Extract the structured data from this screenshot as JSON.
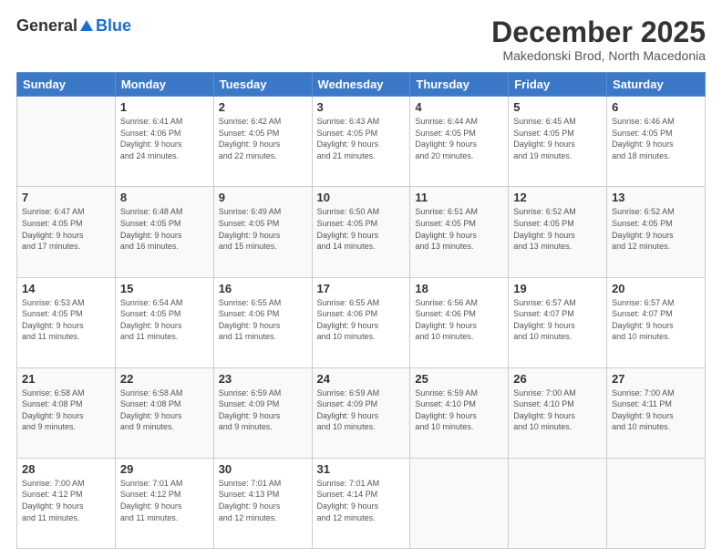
{
  "logo": {
    "general": "General",
    "blue": "Blue"
  },
  "title": "December 2025",
  "subtitle": "Makedonski Brod, North Macedonia",
  "weekdays": [
    "Sunday",
    "Monday",
    "Tuesday",
    "Wednesday",
    "Thursday",
    "Friday",
    "Saturday"
  ],
  "weeks": [
    [
      {
        "day": "",
        "info": ""
      },
      {
        "day": "1",
        "info": "Sunrise: 6:41 AM\nSunset: 4:06 PM\nDaylight: 9 hours\nand 24 minutes."
      },
      {
        "day": "2",
        "info": "Sunrise: 6:42 AM\nSunset: 4:05 PM\nDaylight: 9 hours\nand 22 minutes."
      },
      {
        "day": "3",
        "info": "Sunrise: 6:43 AM\nSunset: 4:05 PM\nDaylight: 9 hours\nand 21 minutes."
      },
      {
        "day": "4",
        "info": "Sunrise: 6:44 AM\nSunset: 4:05 PM\nDaylight: 9 hours\nand 20 minutes."
      },
      {
        "day": "5",
        "info": "Sunrise: 6:45 AM\nSunset: 4:05 PM\nDaylight: 9 hours\nand 19 minutes."
      },
      {
        "day": "6",
        "info": "Sunrise: 6:46 AM\nSunset: 4:05 PM\nDaylight: 9 hours\nand 18 minutes."
      }
    ],
    [
      {
        "day": "7",
        "info": "Sunrise: 6:47 AM\nSunset: 4:05 PM\nDaylight: 9 hours\nand 17 minutes."
      },
      {
        "day": "8",
        "info": "Sunrise: 6:48 AM\nSunset: 4:05 PM\nDaylight: 9 hours\nand 16 minutes."
      },
      {
        "day": "9",
        "info": "Sunrise: 6:49 AM\nSunset: 4:05 PM\nDaylight: 9 hours\nand 15 minutes."
      },
      {
        "day": "10",
        "info": "Sunrise: 6:50 AM\nSunset: 4:05 PM\nDaylight: 9 hours\nand 14 minutes."
      },
      {
        "day": "11",
        "info": "Sunrise: 6:51 AM\nSunset: 4:05 PM\nDaylight: 9 hours\nand 13 minutes."
      },
      {
        "day": "12",
        "info": "Sunrise: 6:52 AM\nSunset: 4:05 PM\nDaylight: 9 hours\nand 13 minutes."
      },
      {
        "day": "13",
        "info": "Sunrise: 6:52 AM\nSunset: 4:05 PM\nDaylight: 9 hours\nand 12 minutes."
      }
    ],
    [
      {
        "day": "14",
        "info": "Sunrise: 6:53 AM\nSunset: 4:05 PM\nDaylight: 9 hours\nand 11 minutes."
      },
      {
        "day": "15",
        "info": "Sunrise: 6:54 AM\nSunset: 4:05 PM\nDaylight: 9 hours\nand 11 minutes."
      },
      {
        "day": "16",
        "info": "Sunrise: 6:55 AM\nSunset: 4:06 PM\nDaylight: 9 hours\nand 11 minutes."
      },
      {
        "day": "17",
        "info": "Sunrise: 6:55 AM\nSunset: 4:06 PM\nDaylight: 9 hours\nand 10 minutes."
      },
      {
        "day": "18",
        "info": "Sunrise: 6:56 AM\nSunset: 4:06 PM\nDaylight: 9 hours\nand 10 minutes."
      },
      {
        "day": "19",
        "info": "Sunrise: 6:57 AM\nSunset: 4:07 PM\nDaylight: 9 hours\nand 10 minutes."
      },
      {
        "day": "20",
        "info": "Sunrise: 6:57 AM\nSunset: 4:07 PM\nDaylight: 9 hours\nand 10 minutes."
      }
    ],
    [
      {
        "day": "21",
        "info": "Sunrise: 6:58 AM\nSunset: 4:08 PM\nDaylight: 9 hours\nand 9 minutes."
      },
      {
        "day": "22",
        "info": "Sunrise: 6:58 AM\nSunset: 4:08 PM\nDaylight: 9 hours\nand 9 minutes."
      },
      {
        "day": "23",
        "info": "Sunrise: 6:59 AM\nSunset: 4:09 PM\nDaylight: 9 hours\nand 9 minutes."
      },
      {
        "day": "24",
        "info": "Sunrise: 6:59 AM\nSunset: 4:09 PM\nDaylight: 9 hours\nand 10 minutes."
      },
      {
        "day": "25",
        "info": "Sunrise: 6:59 AM\nSunset: 4:10 PM\nDaylight: 9 hours\nand 10 minutes."
      },
      {
        "day": "26",
        "info": "Sunrise: 7:00 AM\nSunset: 4:10 PM\nDaylight: 9 hours\nand 10 minutes."
      },
      {
        "day": "27",
        "info": "Sunrise: 7:00 AM\nSunset: 4:11 PM\nDaylight: 9 hours\nand 10 minutes."
      }
    ],
    [
      {
        "day": "28",
        "info": "Sunrise: 7:00 AM\nSunset: 4:12 PM\nDaylight: 9 hours\nand 11 minutes."
      },
      {
        "day": "29",
        "info": "Sunrise: 7:01 AM\nSunset: 4:12 PM\nDaylight: 9 hours\nand 11 minutes."
      },
      {
        "day": "30",
        "info": "Sunrise: 7:01 AM\nSunset: 4:13 PM\nDaylight: 9 hours\nand 12 minutes."
      },
      {
        "day": "31",
        "info": "Sunrise: 7:01 AM\nSunset: 4:14 PM\nDaylight: 9 hours\nand 12 minutes."
      },
      {
        "day": "",
        "info": ""
      },
      {
        "day": "",
        "info": ""
      },
      {
        "day": "",
        "info": ""
      }
    ]
  ]
}
